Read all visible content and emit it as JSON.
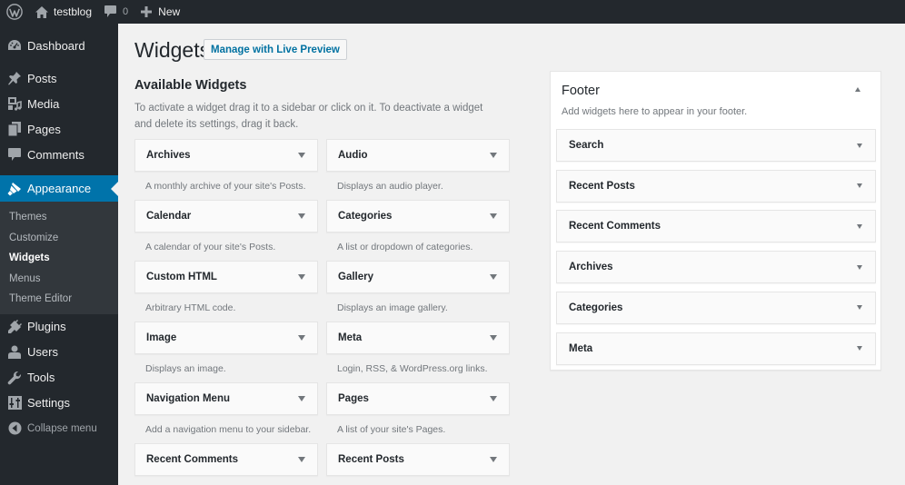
{
  "adminbar": {
    "site_name": "testblog",
    "comments_count": "0",
    "new_label": "New"
  },
  "menu": {
    "dashboard": "Dashboard",
    "posts": "Posts",
    "media": "Media",
    "pages": "Pages",
    "comments": "Comments",
    "appearance": "Appearance",
    "appearance_sub": [
      "Themes",
      "Customize",
      "Widgets",
      "Menus",
      "Theme Editor"
    ],
    "current_sub": "Widgets",
    "plugins": "Plugins",
    "users": "Users",
    "tools": "Tools",
    "settings": "Settings",
    "collapse": "Collapse menu"
  },
  "page": {
    "title": "Widgets",
    "live_preview_button": "Manage with Live Preview"
  },
  "available": {
    "title": "Available Widgets",
    "description": "To activate a widget drag it to a sidebar or click on it. To deactivate a widget and delete its settings, drag it back.",
    "widgets": [
      {
        "title": "Archives",
        "desc": "A monthly archive of your site's Posts."
      },
      {
        "title": "Audio",
        "desc": "Displays an audio player."
      },
      {
        "title": "Calendar",
        "desc": "A calendar of your site's Posts."
      },
      {
        "title": "Categories",
        "desc": "A list or dropdown of categories."
      },
      {
        "title": "Custom HTML",
        "desc": "Arbitrary HTML code."
      },
      {
        "title": "Gallery",
        "desc": "Displays an image gallery."
      },
      {
        "title": "Image",
        "desc": "Displays an image."
      },
      {
        "title": "Meta",
        "desc": "Login, RSS, & WordPress.org links."
      },
      {
        "title": "Navigation Menu",
        "desc": "Add a navigation menu to your sidebar."
      },
      {
        "title": "Pages",
        "desc": "A list of your site's Pages."
      },
      {
        "title": "Recent Comments",
        "desc": ""
      },
      {
        "title": "Recent Posts",
        "desc": ""
      }
    ]
  },
  "footer_sidebar": {
    "title": "Footer",
    "description": "Add widgets here to appear in your footer.",
    "widgets": [
      "Search",
      "Recent Posts",
      "Recent Comments",
      "Archives",
      "Categories",
      "Meta"
    ]
  },
  "colors": {
    "adminbar_bg": "#23282d",
    "accent": "#0073aa",
    "page_bg": "#f1f1f1",
    "link": "#0071a1"
  }
}
